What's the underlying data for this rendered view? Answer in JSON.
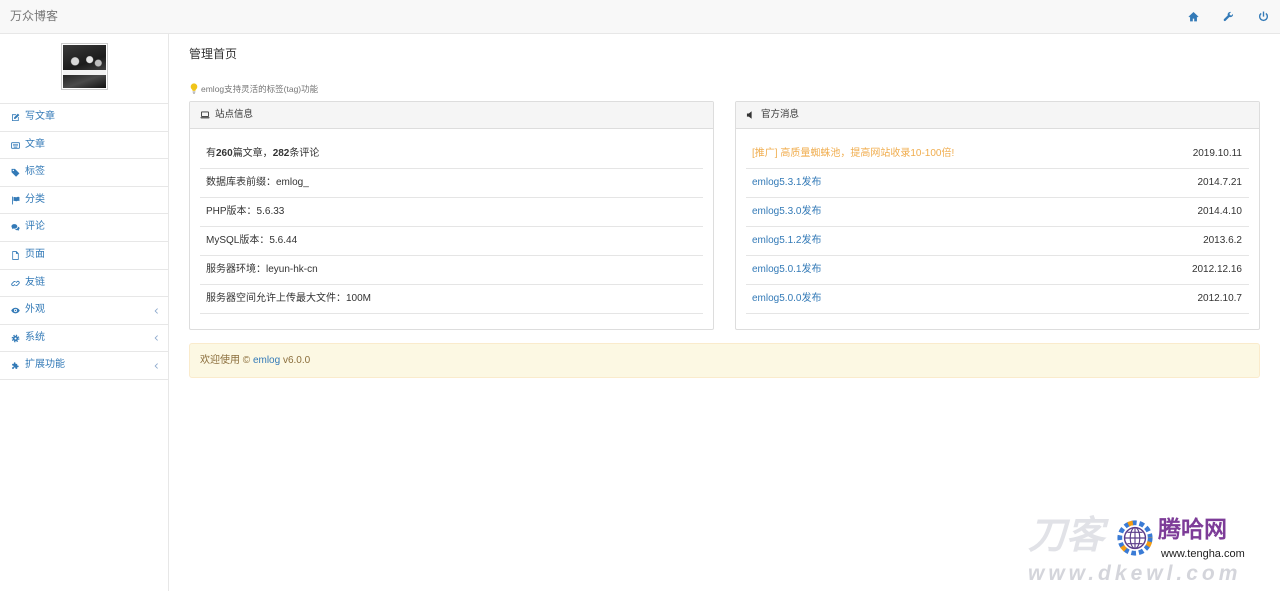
{
  "colors": {
    "accent": "#337ab7",
    "promo": "#f0ad4e",
    "alert_bg": "#fcf8e3",
    "alert_border": "#faebcc",
    "alert_text": "#8a6d3b",
    "watermark_brand": "#7d3c98"
  },
  "navbar": {
    "brand": "万众博客",
    "icons": [
      "home-icon",
      "wrench-icon",
      "power-icon"
    ]
  },
  "sidebar": {
    "items": [
      {
        "label": "写文章",
        "icon": "edit-icon"
      },
      {
        "label": "文章",
        "icon": "list-icon"
      },
      {
        "label": "标签",
        "icon": "tags-icon"
      },
      {
        "label": "分类",
        "icon": "flag-icon"
      },
      {
        "label": "评论",
        "icon": "comments-icon"
      },
      {
        "label": "页面",
        "icon": "file-icon"
      },
      {
        "label": "友链",
        "icon": "link-icon"
      },
      {
        "label": "外观",
        "icon": "eye-icon",
        "has_submenu": true
      },
      {
        "label": "系统",
        "icon": "gear-icon",
        "has_submenu": true
      },
      {
        "label": "扩展功能",
        "icon": "puzzle-icon",
        "has_submenu": true
      }
    ]
  },
  "main": {
    "title": "管理首页",
    "tip": {
      "icon": "lightbulb-icon",
      "text": "emlog支持灵活的标签(tag)功能"
    }
  },
  "site_info": {
    "heading": "站点信息",
    "icon": "laptop-icon",
    "stats": {
      "prefix": "有",
      "posts": "260",
      "mid": "篇文章，",
      "comments": "282",
      "suffix": "条评论"
    },
    "rows": [
      "数据库表前缀：emlog_",
      "PHP版本：5.6.33",
      "MySQL版本：5.6.44",
      "服务器环境：leyun-hk-cn",
      "服务器空间允许上传最大文件：100M"
    ]
  },
  "news": {
    "heading": "官方消息",
    "icon": "volume-icon",
    "items": [
      {
        "title": "[推广] 高质量蜘蛛池，提高网站收录10-100倍!",
        "date": "2019.10.11",
        "promo": true
      },
      {
        "title": "emlog5.3.1发布",
        "date": "2014.7.21"
      },
      {
        "title": "emlog5.3.0发布",
        "date": "2014.4.10"
      },
      {
        "title": "emlog5.1.2发布",
        "date": "2013.6.2"
      },
      {
        "title": "emlog5.0.1发布",
        "date": "2012.12.16"
      },
      {
        "title": "emlog5.0.0发布",
        "date": "2012.10.7"
      }
    ]
  },
  "footer": {
    "prefix": "欢迎使用 © ",
    "link": "emlog",
    "version": " v6.0.0"
  },
  "watermark": {
    "faded_text": "刀客",
    "brand": "腾哈网",
    "brand_url": "www.tengha.com",
    "bottom_text": "www.dkewl.com"
  }
}
